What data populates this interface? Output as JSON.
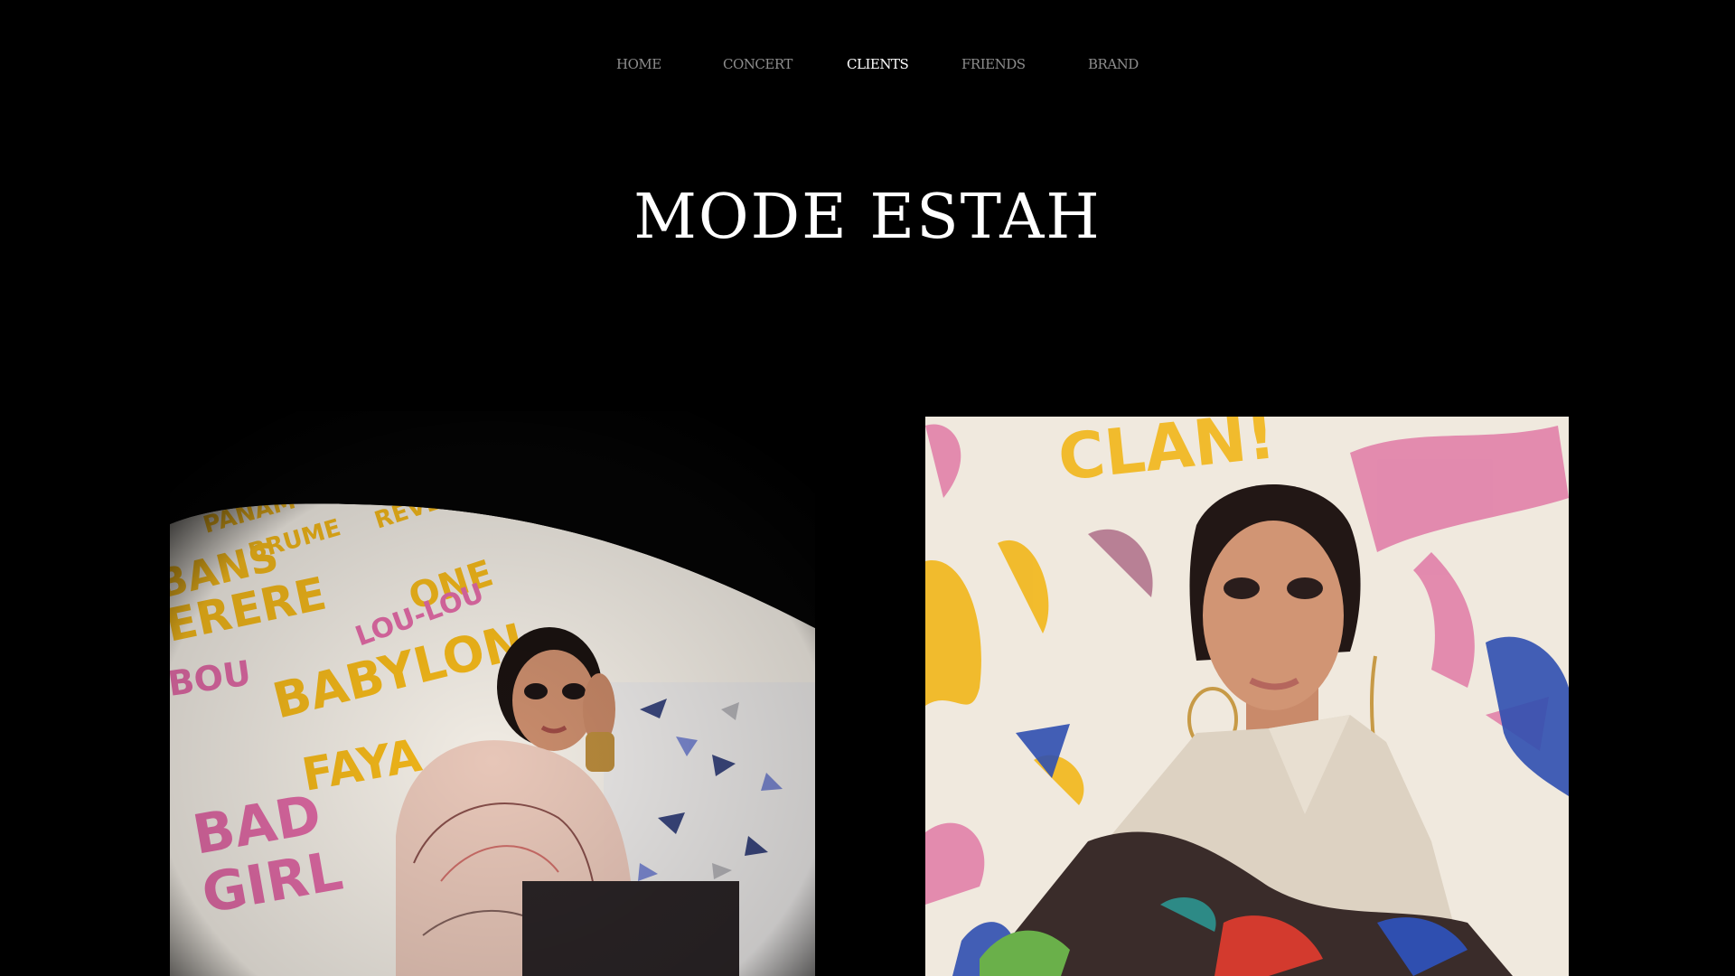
{
  "nav": {
    "items": [
      {
        "label": "HOME",
        "active": false
      },
      {
        "label": "CONCERT",
        "active": false
      },
      {
        "label": "CLIENTS",
        "active": true
      },
      {
        "label": "FRIENDS",
        "active": false
      },
      {
        "label": "BRAND",
        "active": false
      }
    ]
  },
  "brand": {
    "title": "MODE ESTAH"
  },
  "gallery": {
    "left_photo": {
      "graffiti_words": [
        "PANAM",
        "BRUME",
        "BANS",
        "RERE",
        "BOU",
        "BABYLON",
        "FAYA",
        "BAD",
        "GIRL",
        "LOU-LOU",
        "ONE",
        "REVE"
      ]
    },
    "right_photo": {
      "graffiti_words": [
        "CLAN"
      ]
    }
  },
  "colors": {
    "background": "#000000",
    "nav_inactive": "#8d8d8d",
    "nav_active": "#ffffff",
    "graffiti_yellow": "#f2b71a",
    "graffiti_pink": "#e06aa5",
    "graffiti_blue": "#2f4fb0"
  }
}
